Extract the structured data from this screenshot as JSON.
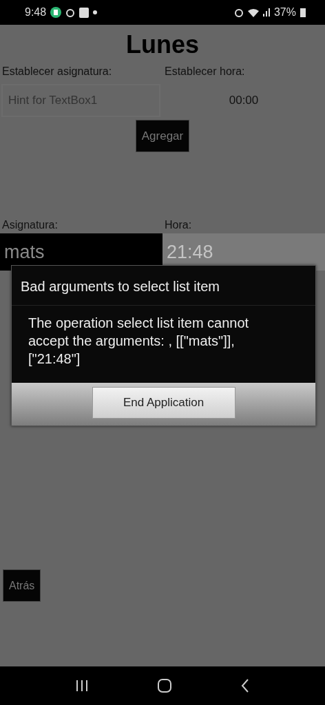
{
  "status_bar": {
    "time": "9:48",
    "battery": "37%"
  },
  "screen": {
    "title": "Lunes",
    "form": {
      "subject_label": "Establecer asignatura:",
      "time_label": "Establecer hora:",
      "subject_field": {
        "placeholder": "Hint for TextBox1"
      },
      "time_picker": "00:00",
      "add_button": "Agregar"
    },
    "list": {
      "subject_header": "Asignatura:",
      "time_header": "Hora:",
      "rows": [
        {
          "subject": "mats",
          "time": "21:48"
        }
      ]
    },
    "back_button": "Atrás"
  },
  "dialog": {
    "title": "Bad arguments to select list item",
    "message": "The operation select list item cannot accept the arguments: , [[\"mats\"]], [\"21:48\"]",
    "button": "End Application"
  }
}
